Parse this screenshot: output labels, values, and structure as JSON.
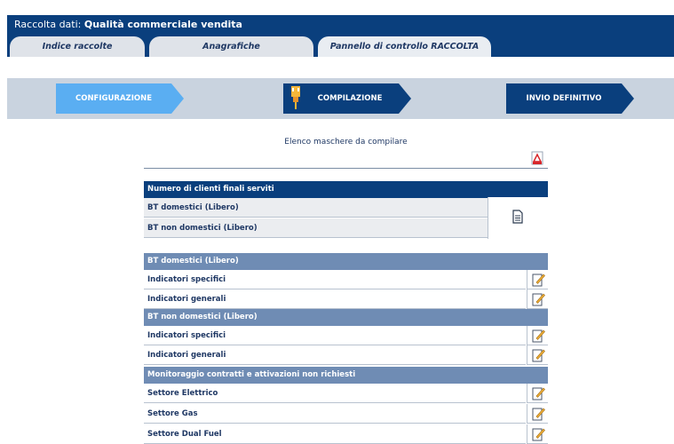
{
  "header": {
    "prefix": "Raccolta dati:",
    "title": "Qualità commerciale vendita"
  },
  "tabs": [
    {
      "label": "Indice raccolte"
    },
    {
      "label": "Anagrafiche"
    },
    {
      "label": "Pannello di controllo RACCOLTA"
    }
  ],
  "steps": [
    {
      "label": "CONFIGURAZIONE"
    },
    {
      "label": "COMPILAZIONE"
    },
    {
      "label": "INVIO DEFINITIVO"
    }
  ],
  "list_title": "Elenco maschere da compilare",
  "clients": {
    "header": "Numero di clienti finali serviti",
    "rows": [
      "BT domestici (Libero)",
      "BT non domestici (Libero)"
    ]
  },
  "sections": [
    {
      "header": "BT domestici (Libero)",
      "rows": [
        "Indicatori specifici",
        "Indicatori generali"
      ]
    },
    {
      "header": "BT non domestici (Libero)",
      "rows": [
        "Indicatori specifici",
        "Indicatori generali"
      ]
    },
    {
      "header": "Monitoraggio contratti e attivazioni non richiesti",
      "rows": [
        "Settore Elettrico",
        "Settore Gas",
        "Settore Dual Fuel"
      ]
    }
  ],
  "colors": {
    "primary": "#0a3f7d",
    "active_step": "#5aaef2",
    "section_header": "#6f8cb4"
  },
  "icons": {
    "pdf": "pdf-icon",
    "document": "document-icon",
    "edit": "edit-icon",
    "plug": "plug-icon"
  }
}
